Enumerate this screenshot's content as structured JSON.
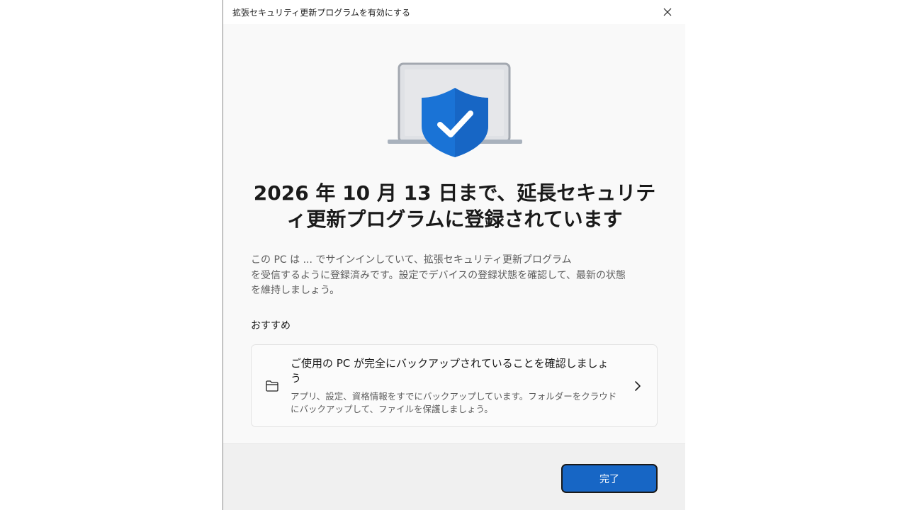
{
  "window": {
    "title": "拡張セキュリティ更新プログラムを有効にする",
    "close_icon": "close-icon"
  },
  "hero": {
    "icon": "laptop-shield-checkmark-icon",
    "colors": {
      "shield": "#1a73d6",
      "laptop": "#c9ccd1"
    }
  },
  "main": {
    "heading_line1": "2026 年 10 月 13 日まで、延長セキュリテ",
    "heading_line2": "ィ更新プログラムに登録されています",
    "body_line1": "この PC は ... でサインインしていて、拡張セキュリティ更新プログラム",
    "body_line2": "を受信するように登録済みです。設定でデバイスの登録状態を確認して、最新の状態",
    "body_line3": "を維持しましょう。"
  },
  "recommend": {
    "label": "おすすめ",
    "card": {
      "icon": "folder-icon",
      "title": "ご使用の PC が完全にバックアップされていることを確認しましょう",
      "description": "アプリ、設定、資格情報をすでにバックアップしています。フォルダーをクラウドにバックアップして、ファイルを保護しましょう。",
      "chevron_icon": "chevron-right-icon"
    }
  },
  "footer": {
    "done_label": "完了",
    "accent": "#1766c5"
  }
}
